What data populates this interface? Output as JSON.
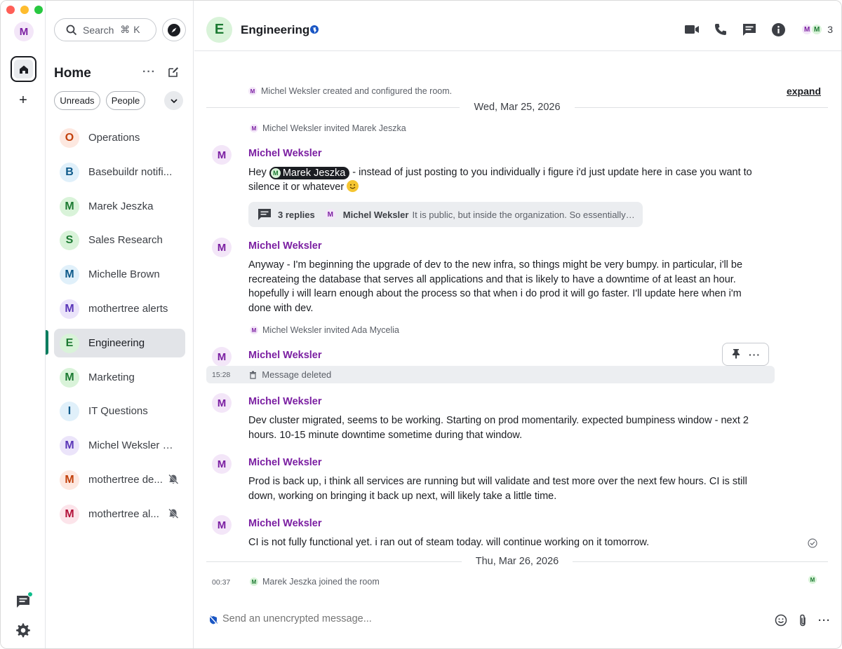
{
  "spaces_rail": {
    "user_initial": "M",
    "home_label": "Home",
    "create_space": "+"
  },
  "roomlist": {
    "search_label": "Search",
    "search_shortcut": "⌘ K",
    "title": "Home",
    "filters": [
      "Unreads",
      "People"
    ],
    "rooms": [
      {
        "initial": "O",
        "name": "Operations",
        "color": "#c2410c",
        "bg": "#fde8e0",
        "badge": "none"
      },
      {
        "initial": "B",
        "name": "Basebuildr notifi...",
        "color": "#0e5a8a",
        "bg": "#e0f0fa",
        "badge": "globe"
      },
      {
        "initial": "M",
        "name": "Marek Jeszka",
        "color": "#1c7a32",
        "bg": "#d9f3d9",
        "badge": "away"
      },
      {
        "initial": "S",
        "name": "Sales Research",
        "color": "#1c7a32",
        "bg": "#d9f3d9",
        "badge": "none"
      },
      {
        "initial": "M",
        "name": "Michelle Brown",
        "color": "#0e5a8a",
        "bg": "#e0f0fa",
        "badge": "offline"
      },
      {
        "initial": "M",
        "name": "mothertree alerts",
        "color": "#5b36b8",
        "bg": "#ebe4fa",
        "badge": "none"
      },
      {
        "initial": "E",
        "name": "Engineering",
        "color": "#1c7a32",
        "bg": "#d9f3d9",
        "badge": "globe",
        "active": true
      },
      {
        "initial": "M",
        "name": "Marketing",
        "color": "#1c7a32",
        "bg": "#d9f3d9",
        "badge": "globe"
      },
      {
        "initial": "I",
        "name": "IT Questions",
        "color": "#0e5a8a",
        "bg": "#e0f0fa",
        "badge": "none"
      },
      {
        "initial": "M",
        "name": "Michel Weksler (...",
        "color": "#5b36b8",
        "bg": "#ebe4fa",
        "badge": "none"
      },
      {
        "initial": "M",
        "name": "mothertree de...",
        "color": "#c2410c",
        "bg": "#fde8e0",
        "badge": "muted"
      },
      {
        "initial": "M",
        "name": "mothertree al...",
        "color": "#b3123b",
        "bg": "#fce4ea",
        "badge": "muted"
      }
    ]
  },
  "header": {
    "room_initial": "E",
    "room_name": "Engineering",
    "member_count": "3",
    "member_initials": [
      "M",
      "M"
    ]
  },
  "timeline": {
    "created_event": "Michel Weksler created and configured the room.",
    "expand_label": "expand",
    "date_1": "Wed, Mar 25, 2026",
    "invite_1": "Michel Weksler invited Marek Jeszka",
    "messages": [
      {
        "sender": "Michel Weksler",
        "initial": "M",
        "pre_mention": "Hey ",
        "mention": "Marek Jeszka",
        "mention_initial": "M",
        "post_mention": " - instead of just posting to you individually i figure i'd just update here in case you want to silence it or whatever "
      },
      {
        "sender": "Michel Weksler",
        "initial": "M",
        "text": "Anyway - I'm beginning the upgrade of dev to the new infra, so things might be very bumpy. in particular, i'll be recreateing the database that serves all applications and that is likely to have a downtime of at least an hour. hopefully i will learn enough about the process so that when i do prod it will go faster. I'll update here when i'm done with dev."
      },
      {
        "sender": "Michel Weksler",
        "initial": "M",
        "time": "15:28",
        "deleted_text": "Message deleted"
      },
      {
        "sender": "Michel Weksler",
        "initial": "M",
        "text": "Dev cluster migrated, seems to be working. Starting on prod momentarily. expected bumpiness window - next 2 hours. 10-15 minute downtime sometime during that window."
      },
      {
        "sender": "Michel Weksler",
        "initial": "M",
        "text": "Prod is back up, i think all services are running but will validate and test more over the next few hours. CI is still down, working on bringing it back up next, will likely take a little time."
      },
      {
        "sender": "Michel Weksler",
        "initial": "M",
        "text": "CI is not fully functional yet. i ran out of steam today. will continue working on it tomorrow."
      }
    ],
    "thread": {
      "replies": "3 replies",
      "author_initial": "M",
      "author": "Michel Weksler",
      "preview": "It is public, but inside the organization. So essentially a..."
    },
    "invite_2": "Michel Weksler invited Ada Mycelia",
    "date_2": "Thu, Mar 26, 2026",
    "join_time": "00:37",
    "join_event": "Marek Jeszka joined the room",
    "join_initial": "M"
  },
  "composer": {
    "placeholder": "Send an unencrypted message..."
  },
  "colors": {
    "accent": "#0dbd8b",
    "sender": "#7b1fa2"
  }
}
